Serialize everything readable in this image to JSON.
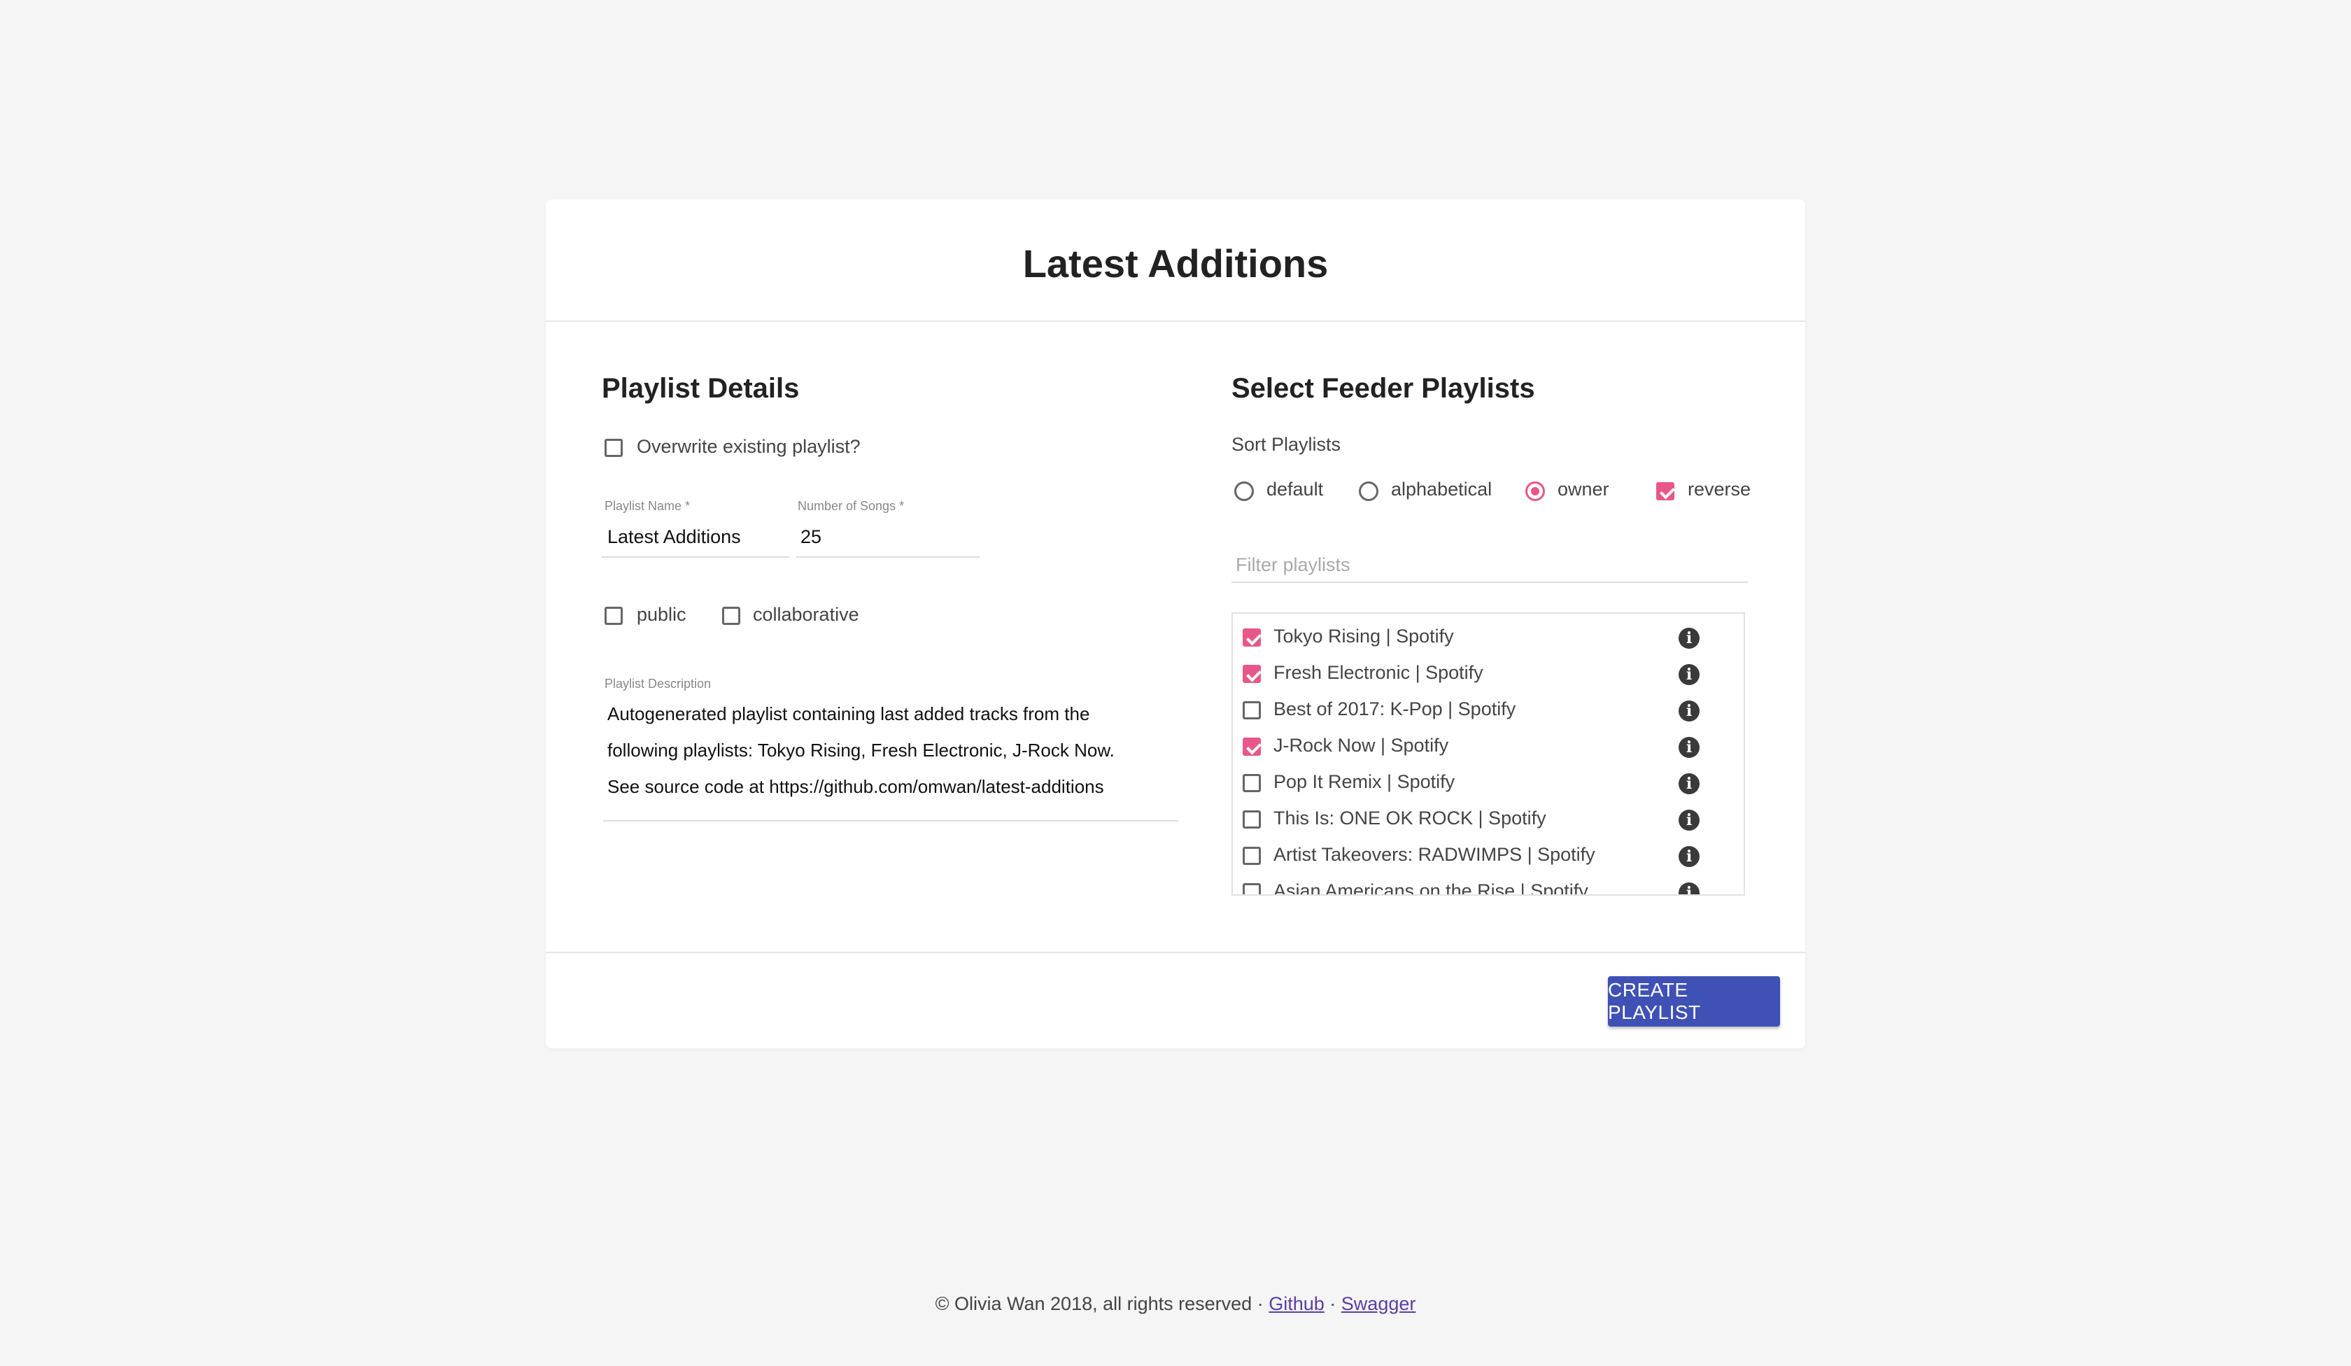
{
  "header": {
    "title": "Latest Additions"
  },
  "details": {
    "section_title": "Playlist Details",
    "overwrite_label": "Overwrite existing playlist?",
    "overwrite_checked": false,
    "name_label": "Playlist Name *",
    "name_value": "Latest Additions",
    "songs_label": "Number of Songs *",
    "songs_value": "25",
    "public_label": "public",
    "public_checked": false,
    "collaborative_label": "collaborative",
    "collaborative_checked": false,
    "description_label": "Playlist Description",
    "description_lines": [
      "Autogenerated playlist containing last added tracks from the",
      "following playlists: Tokyo Rising, Fresh Electronic, J-Rock Now.",
      "See source code at https://github.com/omwan/latest-additions"
    ]
  },
  "feeder": {
    "section_title": "Select Feeder Playlists",
    "sort_label": "Sort Playlists",
    "sort_options": [
      "default",
      "alphabetical",
      "owner"
    ],
    "sort_selected": "owner",
    "reverse_label": "reverse",
    "reverse_checked": true,
    "filter_placeholder": "Filter playlists",
    "playlists": [
      {
        "label": "Tokyo Rising | Spotify",
        "checked": true
      },
      {
        "label": "Fresh Electronic | Spotify",
        "checked": true
      },
      {
        "label": "Best of 2017: K-Pop | Spotify",
        "checked": false
      },
      {
        "label": "J-Rock Now | Spotify",
        "checked": true
      },
      {
        "label": "Pop It Remix | Spotify",
        "checked": false
      },
      {
        "label": "This Is: ONE OK ROCK | Spotify",
        "checked": false
      },
      {
        "label": "Artist Takeovers: RADWIMPS | Spotify",
        "checked": false
      },
      {
        "label": "Asian Americans on the Rise | Spotify",
        "checked": false
      }
    ]
  },
  "actions": {
    "create_label": "CREATE PLAYLIST"
  },
  "footer": {
    "copyright": "© Olivia Wan 2018, all rights reserved ·",
    "github_label": "Github",
    "separator": "·",
    "swagger_label": "Swagger"
  },
  "colors": {
    "accent": "#e8578a",
    "button": "#3f51b5",
    "background": "#f5f5f5"
  }
}
